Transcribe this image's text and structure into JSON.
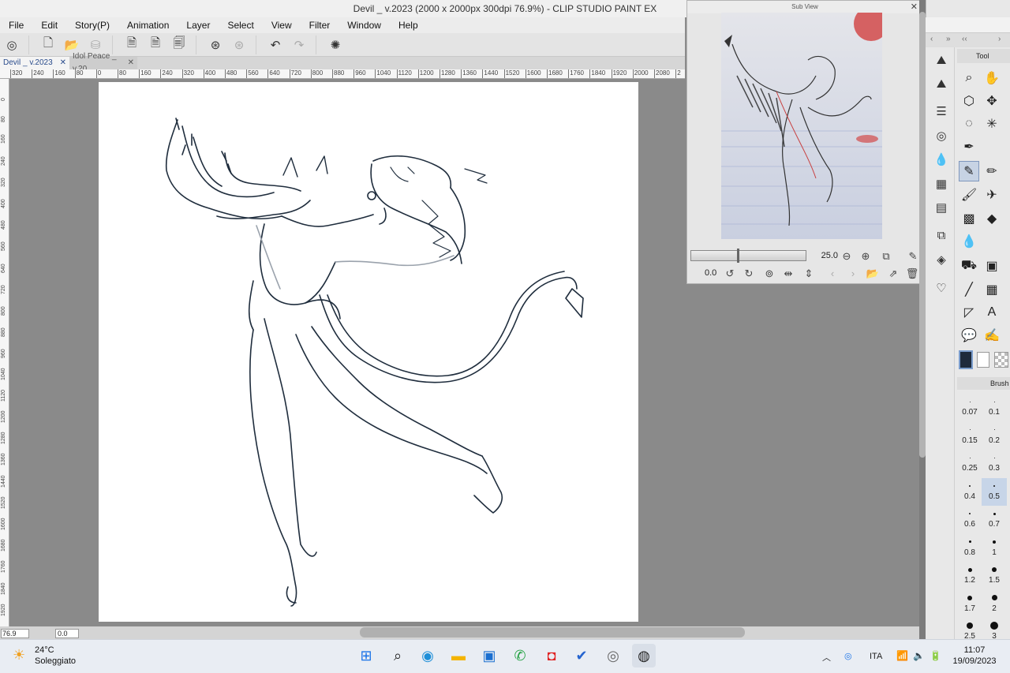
{
  "window": {
    "title": "Devil _ v.2023 (2000 x 2000px 300dpi 76.9%)  - CLIP STUDIO PAINT EX",
    "buttons": [
      "—",
      "☐",
      "✕"
    ]
  },
  "menu": [
    "File",
    "Edit",
    "Story(P)",
    "Animation",
    "Layer",
    "Select",
    "View",
    "Filter",
    "Window",
    "Help"
  ],
  "tabs": [
    {
      "label": "Devil _ v.2023",
      "close": "✕"
    },
    {
      "label": "Idol Peace _ v.20",
      "close": "✕"
    }
  ],
  "ruler_top": [
    "320",
    "240",
    "160",
    "80",
    "0",
    "80",
    "160",
    "240",
    "320",
    "400",
    "480",
    "560",
    "640",
    "720",
    "800",
    "880",
    "960",
    "1040",
    "1120",
    "1200",
    "1280",
    "1360",
    "1440",
    "1520",
    "1600",
    "1680",
    "1760",
    "1840",
    "1920",
    "2000",
    "2080",
    "2"
  ],
  "ruler_left": [
    "0",
    "80",
    "160",
    "240",
    "320",
    "400",
    "480",
    "560",
    "640",
    "720",
    "800",
    "880",
    "960",
    "1040",
    "1120",
    "1200",
    "1280",
    "1360",
    "1440",
    "1520",
    "1600",
    "1680",
    "1760",
    "1840",
    "1920"
  ],
  "status": {
    "zoom": "76.9",
    "angle": "0.0"
  },
  "subview": {
    "title": "Sub View",
    "zoom": "25.0",
    "angle": "0.0"
  },
  "tool_panel": {
    "header": "Tool"
  },
  "brush_panel": {
    "header": "Brush",
    "sizes": [
      "0.07",
      "0.1",
      "0.15",
      "0.2",
      "0.25",
      "0.3",
      "0.4",
      "0.5",
      "0.6",
      "0.7",
      "0.8",
      "1",
      "1.2",
      "1.5",
      "1.7",
      "2",
      "2.5",
      "3"
    ],
    "selected": "0.5"
  },
  "colors": {
    "main": "#1e2a3c",
    "sub": "#ffffff",
    "accent": "#7f97bd"
  },
  "taskbar": {
    "weather_temp": "24°C",
    "weather_desc": "Soleggiato",
    "language": "ITA",
    "time": "11:07",
    "date": "19/09/2023"
  }
}
